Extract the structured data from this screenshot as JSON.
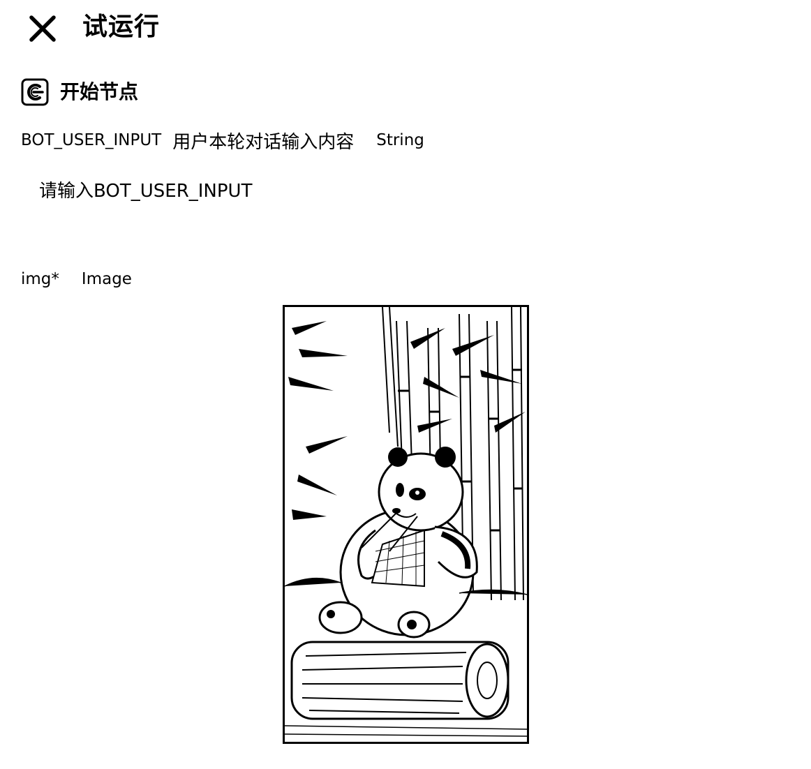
{
  "header": {
    "title": "试运行",
    "close_icon": "close-icon"
  },
  "node": {
    "icon": "start-node-icon",
    "title": "开始节点"
  },
  "params": [
    {
      "name": "BOT_USER_INPUT",
      "description": "用户本轮对话输入内容",
      "type": "String",
      "placeholder": "请输入BOT_USER_INPUT"
    },
    {
      "name": "img*",
      "type": "Image",
      "image_subject": "panda-in-bamboo-forest"
    }
  ]
}
